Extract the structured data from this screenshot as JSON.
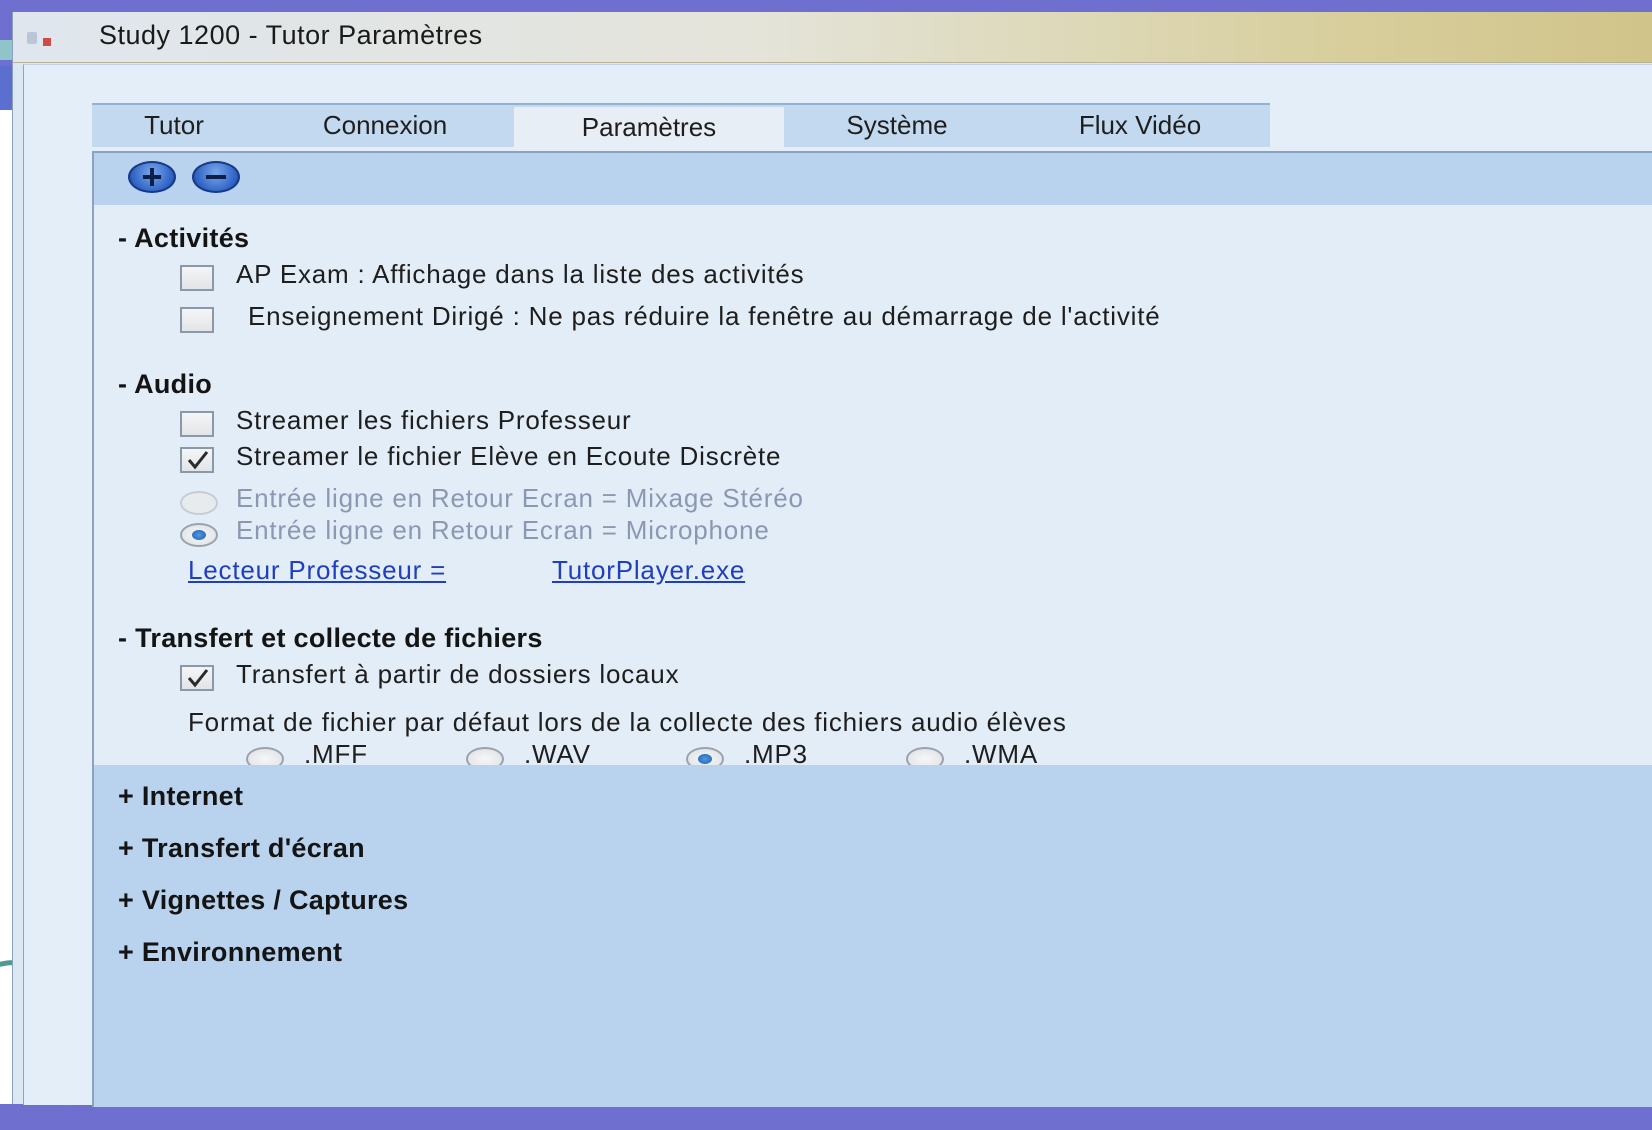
{
  "window": {
    "title": "Study 1200 - Tutor Paramètres",
    "app_icon": "tutor-app-icon"
  },
  "tabs": [
    {
      "label": "Tutor",
      "active": false
    },
    {
      "label": "Connexion",
      "active": false
    },
    {
      "label": "Paramètres",
      "active": true
    },
    {
      "label": "Système",
      "active": false
    },
    {
      "label": "Flux Vidéo",
      "active": false
    }
  ],
  "toolbar": {
    "expand_all_icon": "plus-circle-icon",
    "collapse_all_icon": "minus-circle-icon"
  },
  "sections": {
    "activites": {
      "title": "- Activités",
      "items": [
        {
          "label": "AP Exam : Affichage dans la liste des activités",
          "checked": false
        },
        {
          "label": "Enseignement Dirigé : Ne pas réduire la fenêtre au démarrage de l'activité",
          "checked": false
        }
      ]
    },
    "audio": {
      "title": "- Audio",
      "checkboxes": [
        {
          "label": "Streamer les fichiers Professeur",
          "checked": false
        },
        {
          "label": "Streamer le fichier Elève en Ecoute Discrète",
          "checked": true
        }
      ],
      "radios": [
        {
          "label": "Entrée ligne en Retour Ecran = Mixage Stéréo",
          "selected": false,
          "disabled": true
        },
        {
          "label": "Entrée ligne en Retour Ecran = Microphone",
          "selected": true,
          "disabled": true
        }
      ],
      "player_link_label": "Lecteur Professeur =",
      "player_link_value": "TutorPlayer.exe"
    },
    "transfert": {
      "title": "- Transfert et collecte de fichiers",
      "local_folders_label": "Transfert à partir de dossiers locaux",
      "local_folders_checked": true,
      "format_label": "Format de fichier par défaut lors de la collecte des fichiers audio élèves",
      "formats": [
        {
          "label": ".MFF",
          "selected": false
        },
        {
          "label": ".WAV",
          "selected": false
        },
        {
          "label": ".MP3",
          "selected": true
        },
        {
          "label": ".WMA",
          "selected": false
        }
      ]
    },
    "collapsed": [
      {
        "title": "+ Internet"
      },
      {
        "title": "+ Transfert d'écran"
      },
      {
        "title": "+ Vignettes / Captures"
      },
      {
        "title": "+ Environnement"
      }
    ]
  }
}
